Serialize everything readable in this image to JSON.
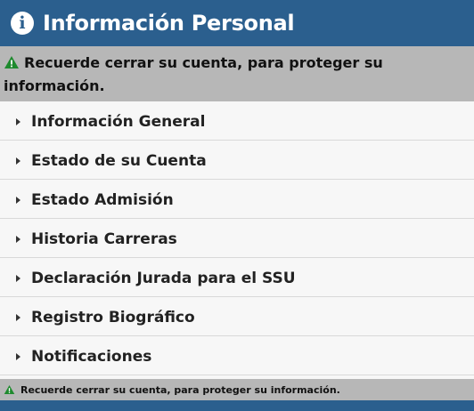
{
  "header": {
    "icon": "info-icon",
    "title": "Información Personal"
  },
  "notice": {
    "icon": "warning-triangle-icon",
    "color": "#1e8a2e",
    "line1": "Recuerde cerrar su cuenta, para proteger su",
    "line2": "información.",
    "bottom_text": "Recuerde cerrar su cuenta, para proteger su información."
  },
  "menu": {
    "items": [
      {
        "label": "Información General"
      },
      {
        "label": "Estado de su Cuenta"
      },
      {
        "label": "Estado Admisión"
      },
      {
        "label": "Historia Carreras"
      },
      {
        "label": "Declaración Jurada para el SSU"
      },
      {
        "label": "Registro Biográfico"
      },
      {
        "label": "Notificaciones"
      }
    ]
  },
  "colors": {
    "header_bg": "#2b5f8e",
    "notice_bg": "#b7b7b7",
    "menu_bg": "#f7f7f7"
  }
}
